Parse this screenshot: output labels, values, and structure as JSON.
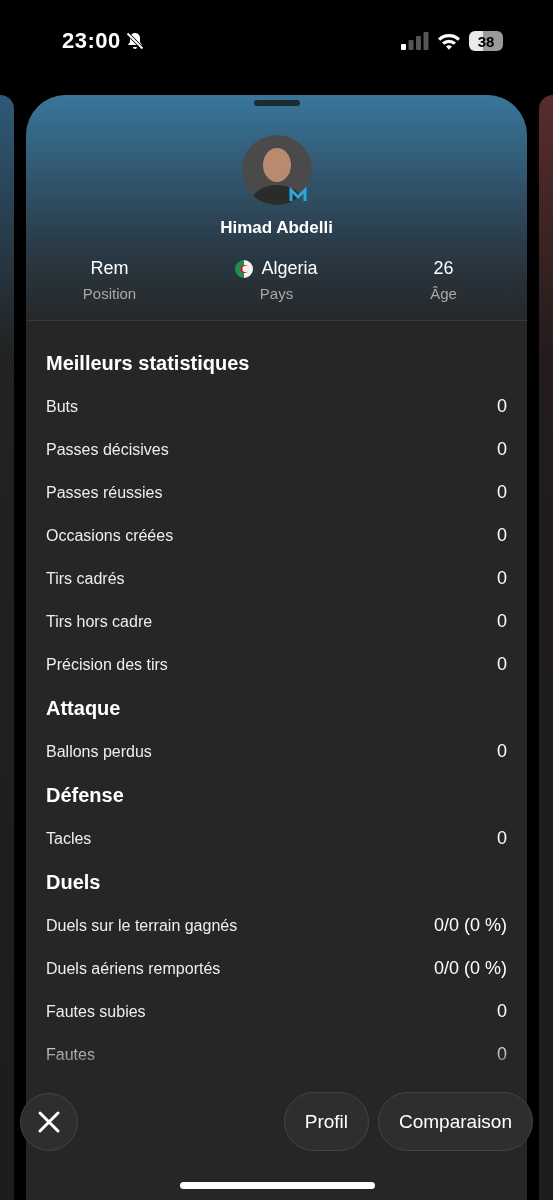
{
  "status_bar": {
    "time": "23:00",
    "battery": "38"
  },
  "player": {
    "name": "Himad Abdelli",
    "info": [
      {
        "value": "Rem",
        "label": "Position",
        "kind": "text"
      },
      {
        "value": "Algeria",
        "label": "Pays",
        "kind": "flag"
      },
      {
        "value": "26",
        "label": "Âge",
        "kind": "text"
      }
    ]
  },
  "sections": [
    {
      "title": "Meilleurs statistiques",
      "rows": [
        {
          "label": "Buts",
          "value": "0"
        },
        {
          "label": "Passes décisives",
          "value": "0"
        },
        {
          "label": "Passes réussies",
          "value": "0"
        },
        {
          "label": "Occasions créées",
          "value": "0"
        },
        {
          "label": "Tirs cadrés",
          "value": "0"
        },
        {
          "label": "Tirs hors cadre",
          "value": "0"
        },
        {
          "label": "Précision des tirs",
          "value": "0"
        }
      ]
    },
    {
      "title": "Attaque",
      "rows": [
        {
          "label": "Ballons perdus",
          "value": "0"
        }
      ]
    },
    {
      "title": "Défense",
      "rows": [
        {
          "label": "Tacles",
          "value": "0"
        }
      ]
    },
    {
      "title": "Duels",
      "rows": [
        {
          "label": "Duels sur le terrain gagnés",
          "value": "0/0 (0 %)"
        },
        {
          "label": "Duels aériens remportés",
          "value": "0/0 (0 %)"
        },
        {
          "label": "Fautes subies",
          "value": "0"
        },
        {
          "label": "Fautes",
          "value": "0"
        }
      ]
    }
  ],
  "buttons": [
    {
      "label": "Profil"
    },
    {
      "label": "Comparaison"
    }
  ]
}
